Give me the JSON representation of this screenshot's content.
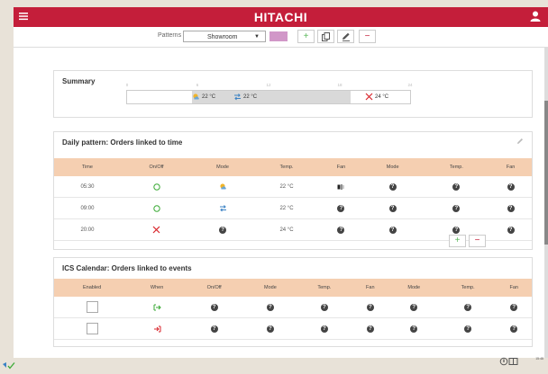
{
  "app": {
    "brand": "HITACHI"
  },
  "patterns": {
    "label": "Patterns",
    "selected": "Showroom",
    "swatch_color": "#d197c8",
    "accent_green": "#5cb85c",
    "accent_red": "#c41e3a"
  },
  "summary": {
    "title": "Summary",
    "ticks": [
      "0",
      "6",
      "12",
      "18",
      "24"
    ],
    "segments": [
      {
        "icon": "sun-cloud-icon",
        "label": "22 °C"
      },
      {
        "icon": "auto-mode-icon",
        "label": "22 °C"
      },
      {
        "icon": "off-x-icon",
        "label": "24 °C"
      }
    ]
  },
  "daily": {
    "title": "Daily pattern: Orders linked to time",
    "headers": [
      "Time",
      "On/Off",
      "Mode",
      "Temp.",
      "Fan",
      "Mode",
      "Temp.",
      "Fan"
    ],
    "rows": [
      {
        "time": "05:30",
        "onoff": "on-circle-icon",
        "mode": "sun-cloud-icon",
        "temp": "22 °C",
        "fan": "fan-speed-icon"
      },
      {
        "time": "09:00",
        "onoff": "on-circle-icon",
        "mode": "auto-mode-icon",
        "temp": "22 °C",
        "fan": "help-icon"
      },
      {
        "time": "20:00",
        "onoff": "off-x-icon",
        "mode": "help-icon",
        "temp": "24 °C",
        "fan": "help-icon"
      }
    ]
  },
  "calendar": {
    "title": "ICS Calendar: Orders linked to events",
    "headers": [
      "Enabled",
      "When",
      "On/Off",
      "Mode",
      "Temp.",
      "Fan",
      "Mode",
      "Temp.",
      "Fan"
    ],
    "rows": [
      {
        "when": "event-start-icon",
        "enabled": false
      },
      {
        "when": "event-end-icon",
        "enabled": false
      }
    ]
  },
  "footer": {
    "clock": "15:48"
  }
}
